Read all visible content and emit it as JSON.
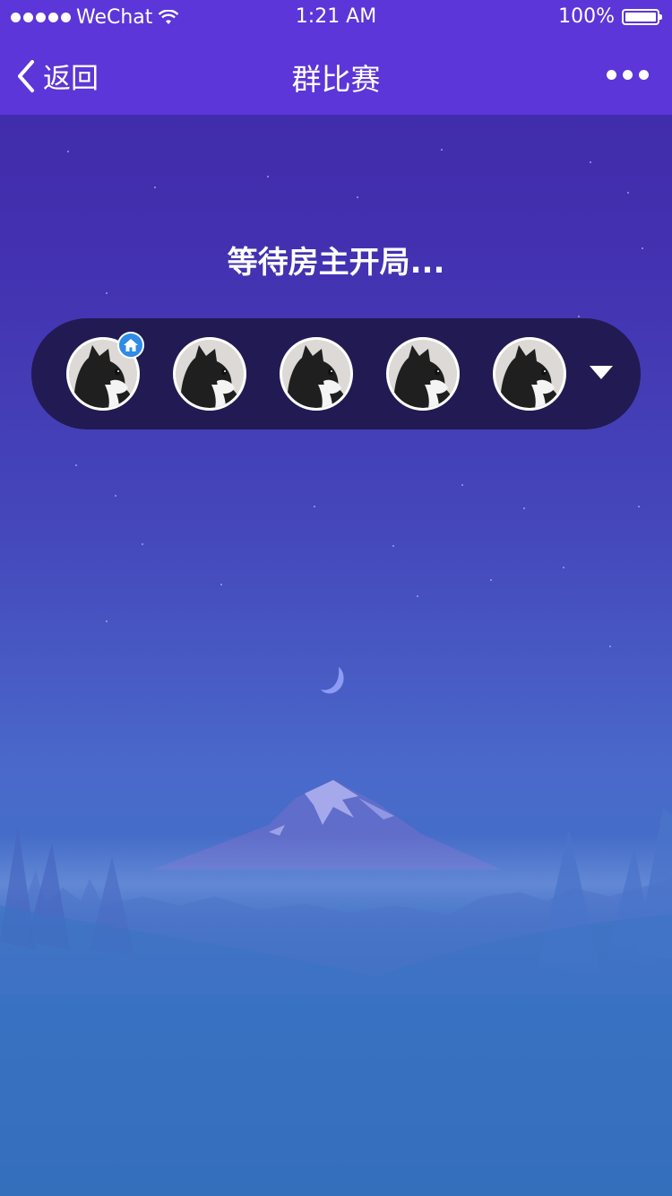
{
  "status_bar": {
    "carrier": "WeChat",
    "time": "1:21 AM",
    "battery": "100%"
  },
  "nav": {
    "back_label": "返回",
    "title": "群比赛"
  },
  "main": {
    "waiting_text": "等待房主开局..."
  },
  "players": [
    {
      "role": "owner",
      "avatar": "cat-avatar"
    },
    {
      "role": "member",
      "avatar": "cat-avatar"
    },
    {
      "role": "member",
      "avatar": "cat-avatar"
    },
    {
      "role": "member",
      "avatar": "cat-avatar"
    },
    {
      "role": "member",
      "avatar": "cat-avatar"
    }
  ],
  "colors": {
    "nav_bg": "#5c36d8",
    "player_bar_bg": "#221a52",
    "owner_badge": "#2f8be6"
  },
  "icons": [
    "back-chevron-icon",
    "more-icon",
    "home-icon",
    "dropdown-triangle-icon",
    "moon-icon",
    "wifi-icon",
    "battery-icon"
  ]
}
